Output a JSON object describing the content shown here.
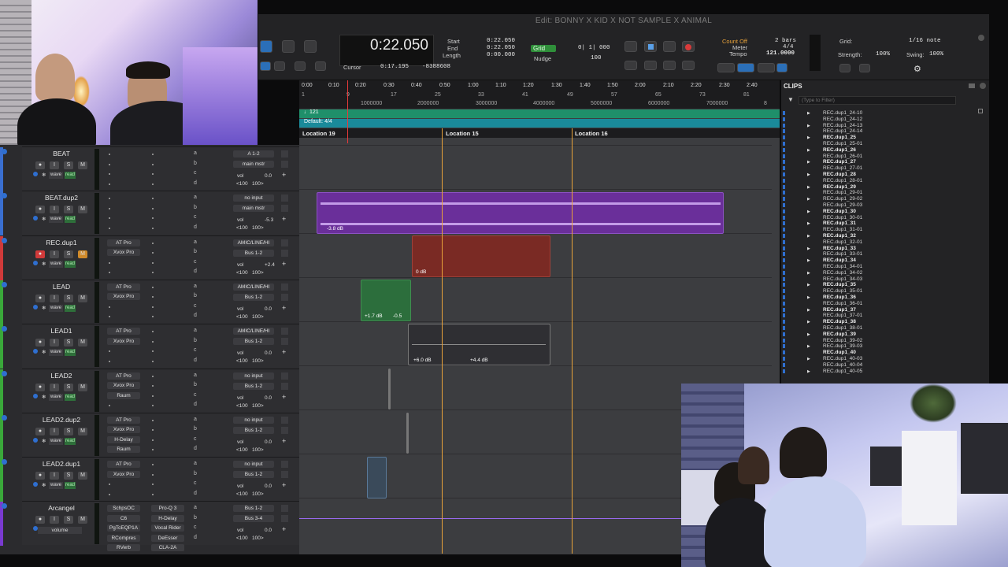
{
  "window": {
    "title": "Edit: BONNY X KID X NOT SAMPLE X ANIMAL"
  },
  "counter": {
    "main": "0:22.050",
    "start_label": "Start",
    "end_label": "End",
    "length_label": "Length",
    "start": "0:22.050",
    "end": "0:22.050",
    "length": "0:00.000",
    "cursor_label": "Cursor",
    "cursor": "0:17.195",
    "cursor_sample": "-8388608"
  },
  "grid": {
    "label": "Grid",
    "value": "0| 1| 000",
    "nudge_label": "Nudge",
    "nudge_value": "100"
  },
  "transport": {
    "count_off": "Count Off",
    "meter_label": "Meter",
    "tempo_label": "Tempo",
    "bars": "2 bars",
    "meter": "4/4",
    "tempo": "121.0000"
  },
  "grid_right": {
    "grid_label": "Grid:",
    "grid_value": "1/16 note",
    "strength_label": "Strength:",
    "strength_value": "100%",
    "swing_label": "Swing:",
    "swing_value": "100%"
  },
  "ruler": {
    "minutes": [
      "0:00",
      "0:10",
      "0:20",
      "0:30",
      "0:40",
      "0:50",
      "1:00",
      "1:10",
      "1:20",
      "1:30",
      "1:40",
      "1:50",
      "2:00",
      "2:10",
      "2:20",
      "2:30",
      "2:40"
    ],
    "bars": [
      "1",
      "9",
      "17",
      "25",
      "33",
      "41",
      "49",
      "57",
      "65",
      "73",
      "81"
    ],
    "samples": [
      "1000000",
      "2000000",
      "3000000",
      "4000000",
      "5000000",
      "6000000",
      "7000000",
      "8"
    ],
    "tempo_marker": "♩121",
    "meter_marker": "Default: 4/4",
    "locations": [
      "Location 19",
      "Location 15",
      "Location 16"
    ]
  },
  "tracks": [
    {
      "name": "BEAT",
      "color": "#3a6fd0",
      "inserts": [],
      "io_in": "A 1-2",
      "io_out": "main mstr",
      "vol": "0.0",
      "pan": "<100   100>",
      "rec": false
    },
    {
      "name": "BEAT.dup2",
      "color": "#3a6fd0",
      "inserts": [],
      "io_in": "no input",
      "io_out": "main mstr",
      "vol": "-5.3",
      "pan": "<100   100>",
      "rec": false
    },
    {
      "name": "REC.dup1",
      "color": "#d03a3a",
      "inserts": [
        "AT Pro",
        "Xvox Pro"
      ],
      "io_in": "AMIC/LINE/HI",
      "io_out": "Bus 1-2",
      "vol": "+2.4",
      "pan": "<100   100>",
      "rec": true
    },
    {
      "name": "LEAD",
      "color": "#3aa83a",
      "inserts": [
        "AT Pro",
        "Xvox Pro"
      ],
      "io_in": "AMIC/LINE/HI",
      "io_out": "Bus 1-2",
      "vol": "0.0",
      "pan": "<100   100>",
      "rec": false
    },
    {
      "name": "LEAD1",
      "color": "#3aa83a",
      "inserts": [
        "AT Pro",
        "Xvox Pro"
      ],
      "io_in": "AMIC/LINE/HI",
      "io_out": "Bus 1-2",
      "vol": "0.0",
      "pan": "<100   100>",
      "rec": false
    },
    {
      "name": "LEAD2",
      "color": "#3aa83a",
      "inserts": [
        "AT Pro",
        "Xvox Pro",
        "Raum"
      ],
      "io_in": "no input",
      "io_out": "Bus 1-2",
      "vol": "0.0",
      "pan": "<100   100>",
      "rec": false
    },
    {
      "name": "LEAD2.dup2",
      "color": "#3aa83a",
      "inserts": [
        "AT Pro",
        "Xvox Pro",
        "H-Delay",
        "Raum"
      ],
      "io_in": "no input",
      "io_out": "Bus 1-2",
      "vol": "0.0",
      "pan": "<100   100>",
      "rec": false
    },
    {
      "name": "LEAD2.dup1",
      "color": "#3aa83a",
      "inserts": [
        "AT Pro",
        "Xvox Pro"
      ],
      "io_in": "no input",
      "io_out": "Bus 1-2",
      "vol": "0.0",
      "pan": "<100   100>",
      "rec": false
    },
    {
      "name": "Arcangel",
      "color": "#7a3ad0",
      "inserts": [
        "SchpsOC",
        "C6",
        "PgTcEQP1A",
        "RCompres",
        "RVerb"
      ],
      "inserts2": [
        "Pro-Q 3",
        "H-Delay",
        "Vocal Rider",
        "DeEsser",
        "CLA-2A"
      ],
      "io_in": "Bus 1-2",
      "io_out": "Bus 3-4",
      "vol": "0.0",
      "pan": "<100   100>",
      "rec": false,
      "mode": "volume"
    }
  ],
  "track_buttons": {
    "solo": "S",
    "mute": "M",
    "input": "I",
    "wave": "wave",
    "read": "read"
  },
  "send_letters": [
    "a",
    "b",
    "c",
    "d"
  ],
  "clips": [
    {
      "track": 1,
      "label": "-3.8 dB"
    },
    {
      "track": 2,
      "label": "0 dB"
    },
    {
      "track": 3,
      "label": "+1.7 dB",
      "label2": "-0.5"
    },
    {
      "track": 4,
      "label": "+6.0 dB",
      "label2": "+4.4 dB"
    }
  ],
  "clips_panel": {
    "title": "CLIPS",
    "filter_placeholder": "(Type to Filter)",
    "items": [
      {
        "name": "REC.dup1_24-10",
        "bold": false
      },
      {
        "name": "REC.dup1_24-12",
        "bold": false
      },
      {
        "name": "REC.dup1_24-13",
        "bold": false
      },
      {
        "name": "REC.dup1_24-14",
        "bold": false
      },
      {
        "name": "REC.dup1_25",
        "bold": true
      },
      {
        "name": "REC.dup1_25-01",
        "bold": false
      },
      {
        "name": "REC.dup1_26",
        "bold": true
      },
      {
        "name": "REC.dup1_26-01",
        "bold": false
      },
      {
        "name": "REC.dup1_27",
        "bold": true
      },
      {
        "name": "REC.dup1_27-01",
        "bold": false
      },
      {
        "name": "REC.dup1_28",
        "bold": true
      },
      {
        "name": "REC.dup1_28-01",
        "bold": false
      },
      {
        "name": "REC.dup1_29",
        "bold": true
      },
      {
        "name": "REC.dup1_29-01",
        "bold": false
      },
      {
        "name": "REC.dup1_29-02",
        "bold": false
      },
      {
        "name": "REC.dup1_29-03",
        "bold": false
      },
      {
        "name": "REC.dup1_30",
        "bold": true
      },
      {
        "name": "REC.dup1_30-01",
        "bold": false
      },
      {
        "name": "REC.dup1_31",
        "bold": true
      },
      {
        "name": "REC.dup1_31-01",
        "bold": false
      },
      {
        "name": "REC.dup1_32",
        "bold": true
      },
      {
        "name": "REC.dup1_32-01",
        "bold": false
      },
      {
        "name": "REC.dup1_33",
        "bold": true
      },
      {
        "name": "REC.dup1_33-01",
        "bold": false
      },
      {
        "name": "REC.dup1_34",
        "bold": true
      },
      {
        "name": "REC.dup1_34-01",
        "bold": false
      },
      {
        "name": "REC.dup1_34-02",
        "bold": false
      },
      {
        "name": "REC.dup1_34-03",
        "bold": false
      },
      {
        "name": "REC.dup1_35",
        "bold": true
      },
      {
        "name": "REC.dup1_35-01",
        "bold": false
      },
      {
        "name": "REC.dup1_36",
        "bold": true
      },
      {
        "name": "REC.dup1_36-01",
        "bold": false
      },
      {
        "name": "REC.dup1_37",
        "bold": true
      },
      {
        "name": "REC.dup1_37-01",
        "bold": false
      },
      {
        "name": "REC.dup1_38",
        "bold": true
      },
      {
        "name": "REC.dup1_38-01",
        "bold": false
      },
      {
        "name": "REC.dup1_39",
        "bold": true
      },
      {
        "name": "REC.dup1_39-02",
        "bold": false
      },
      {
        "name": "REC.dup1_39-03",
        "bold": false
      },
      {
        "name": "REC.dup1_40",
        "bold": true
      },
      {
        "name": "REC.dup1_40-03",
        "bold": false
      },
      {
        "name": "REC.dup1_40-04",
        "bold": false
      },
      {
        "name": "REC.dup1_40-05",
        "bold": false
      }
    ]
  },
  "colors": {
    "accent": "#2f8f3a",
    "playhead": "#e8a23a",
    "clip_purple": "#7a3ad0",
    "clip_red": "#8a2f2a",
    "clip_green": "#2f6f3a"
  }
}
